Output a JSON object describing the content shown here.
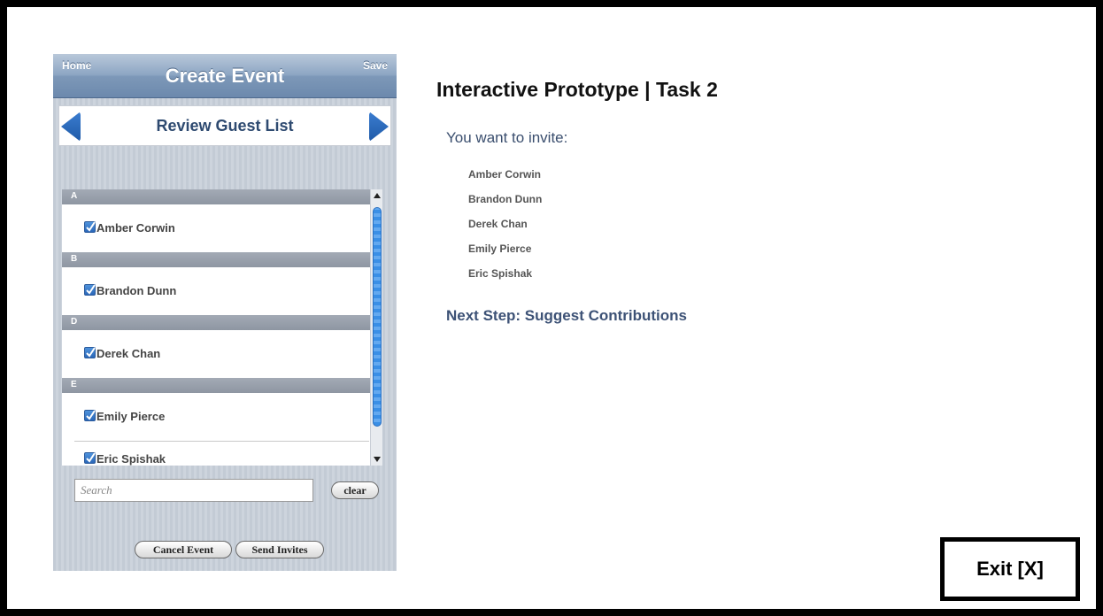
{
  "phone": {
    "nav": {
      "home": "Home",
      "title": "Create Event",
      "save": "Save"
    },
    "review_title": "Review Guest List",
    "sections": [
      {
        "letter": "A",
        "guests": [
          "Amber Corwin"
        ]
      },
      {
        "letter": "B",
        "guests": [
          "Brandon Dunn"
        ]
      },
      {
        "letter": "D",
        "guests": [
          "Derek Chan"
        ]
      },
      {
        "letter": "E",
        "guests": [
          "Emily Pierce",
          "Eric Spishak"
        ]
      }
    ],
    "search": {
      "placeholder": "Search",
      "value": ""
    },
    "clear_label": "clear",
    "cancel_label": "Cancel Event",
    "send_label": "Send Invites"
  },
  "task": {
    "title": "Interactive Prototype | Task 2",
    "prompt": "You want to invite:",
    "invitees": [
      "Amber Corwin",
      "Brandon Dunn",
      "Derek Chan",
      "Emily Pierce",
      "Eric Spishak"
    ],
    "next_step": "Next Step: Suggest Contributions"
  },
  "exit_label": "Exit [X]",
  "colors": {
    "nav_bar": "#7d98b8",
    "accent_blue": "#2a67b8",
    "heading_text": "#3d5276"
  }
}
